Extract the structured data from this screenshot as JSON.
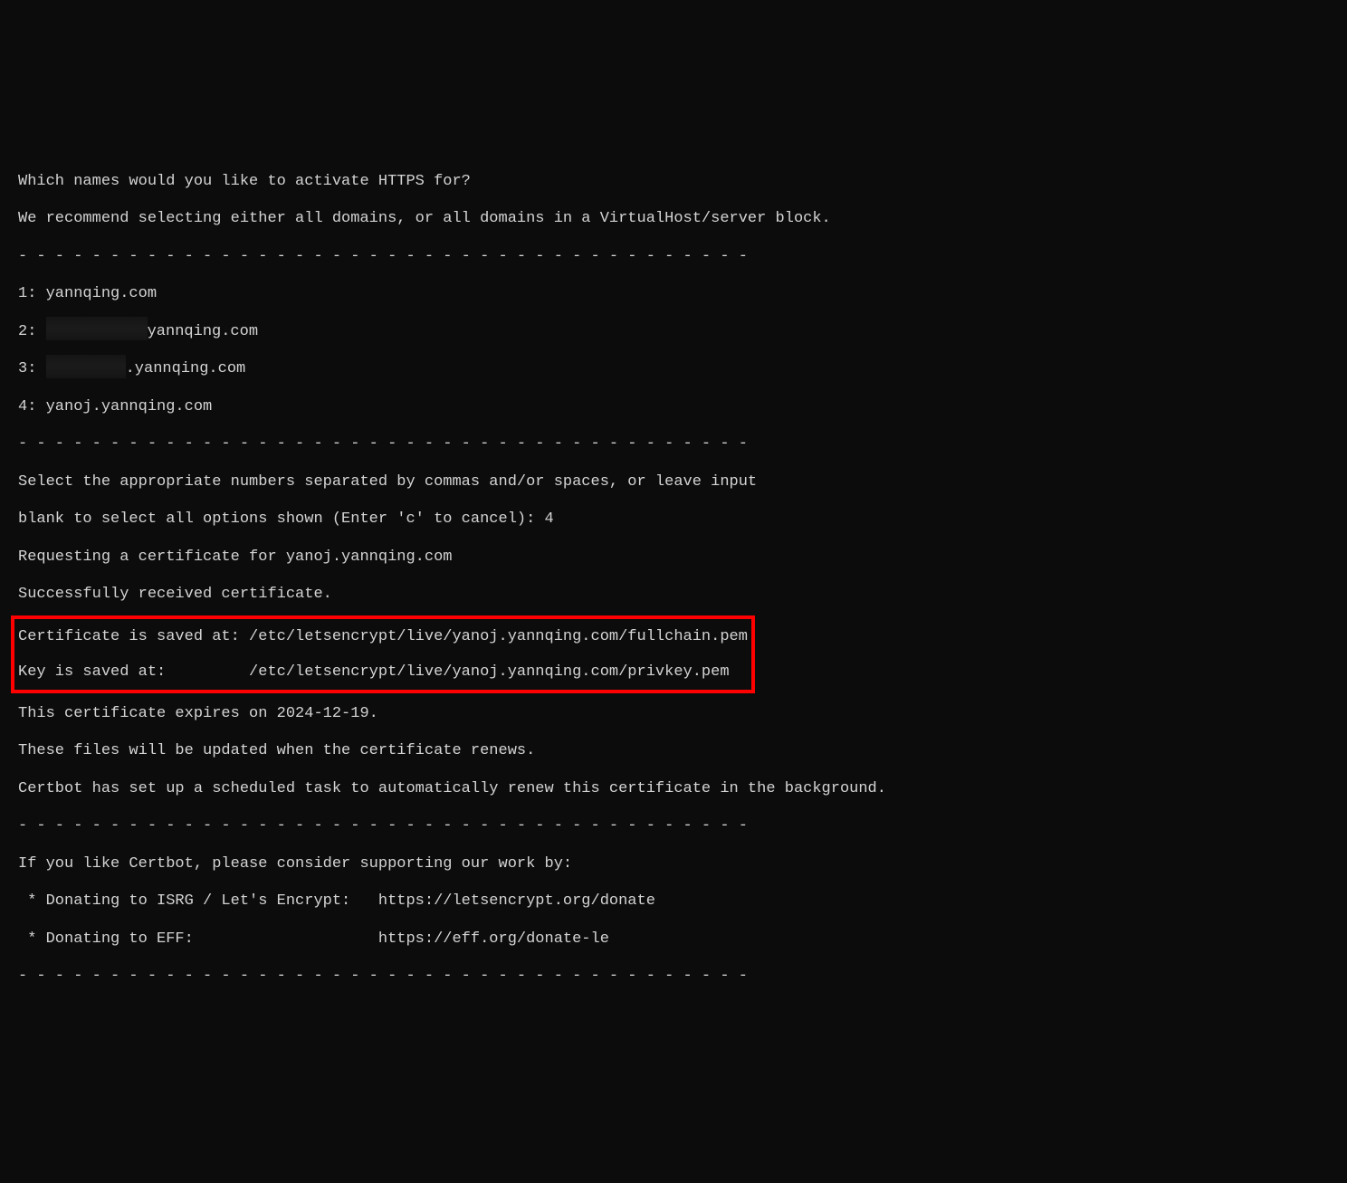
{
  "lines": {
    "q1": "Which names would you like to activate HTTPS for?",
    "q2": "We recommend selecting either all domains, or all domains in a VirtualHost/server block.",
    "dash": "- - - - - - - - - - - - - - - - - - - - - - - - - - - - - - - - - - - - - - - -",
    "item1": "1: yannqing.com",
    "item2_pre": "2: ",
    "item2_post": "yannqing.com",
    "item3_pre": "3: ",
    "item3_post": ".yannqing.com",
    "item4": "4: yanoj.yannqing.com",
    "sel1": "Select the appropriate numbers separated by commas and/or spaces, or leave input",
    "sel2": "blank to select all options shown (Enter 'c' to cancel): 4",
    "req": "Requesting a certificate for yanoj.yannqing.com",
    "blank": "",
    "succ": "Successfully received certificate.",
    "cert": "Certificate is saved at: /etc/letsencrypt/live/yanoj.yannqing.com/fullchain.pem",
    "key": "Key is saved at:         /etc/letsencrypt/live/yanoj.yannqing.com/privkey.pem",
    "exp": "This certificate expires on 2024-12-19.",
    "upd": "These files will be updated when the certificate renews.",
    "bg": "Certbot has set up a scheduled task to automatically renew this certificate in the background.",
    "sup": "If you like Certbot, please consider supporting our work by:",
    "d1": " * Donating to ISRG / Let's Encrypt:   https://letsencrypt.org/donate",
    "d2": " * Donating to EFF:                    https://eff.org/donate-le"
  }
}
